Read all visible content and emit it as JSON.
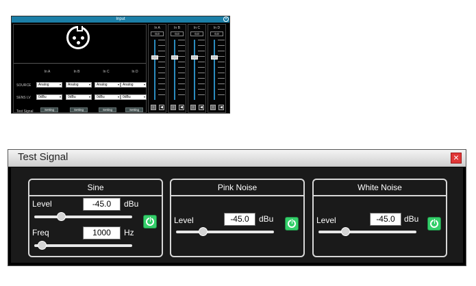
{
  "input_window": {
    "title": "Input",
    "channels": [
      "In A",
      "In B",
      "In C",
      "In D"
    ],
    "source_label": "SOURCE",
    "sens_label": "SENS LV",
    "test_signal_label": "Test Signal",
    "source_values": [
      "Analog",
      "Analog",
      "Analog",
      "Analog"
    ],
    "sens_values": [
      "0dBu",
      "0dBu",
      "0dBu",
      "0dBu"
    ],
    "setting_label": "Setting",
    "strips": [
      {
        "name": "In A",
        "value": "0.0"
      },
      {
        "name": "In B",
        "value": "0.0"
      },
      {
        "name": "In C",
        "value": "0.0"
      },
      {
        "name": "In D",
        "value": "0.0"
      }
    ]
  },
  "test_signal": {
    "title": "Test Signal",
    "sine": {
      "header": "Sine",
      "level_label": "Level",
      "level_value": "-45.0",
      "level_unit": "dBu",
      "level_slider_fraction": 0.25,
      "freq_label": "Freq",
      "freq_value": "1000",
      "freq_unit": "Hz",
      "freq_slider_fraction": 0.04
    },
    "pink_noise": {
      "header": "Pink Noise",
      "level_label": "Level",
      "level_value": "-45.0",
      "level_unit": "dBu",
      "level_slider_fraction": 0.25
    },
    "white_noise": {
      "header": "White Noise",
      "level_label": "Level",
      "level_value": "-45.0",
      "level_unit": "dBu",
      "level_slider_fraction": 0.25
    },
    "colors": {
      "power_on": "#34cf6a",
      "close": "#e03838"
    }
  }
}
